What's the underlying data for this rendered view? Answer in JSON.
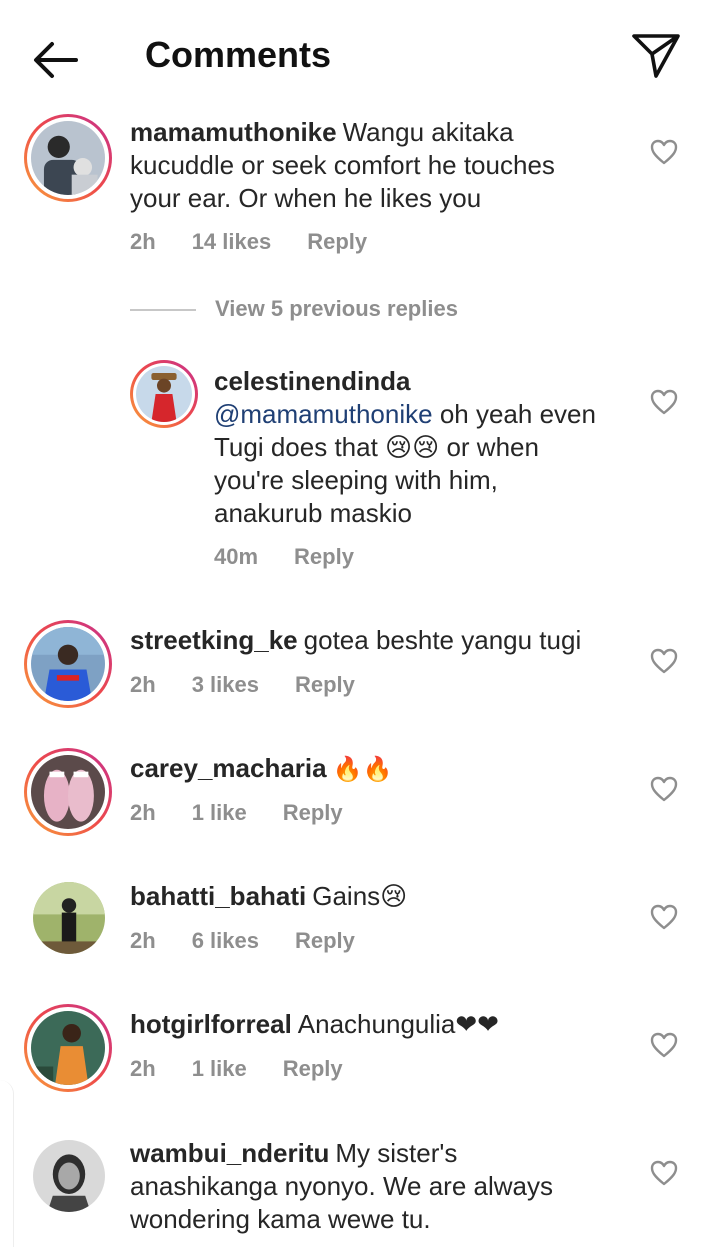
{
  "header": {
    "title": "Comments",
    "back_icon": "arrow-left-icon",
    "share_icon": "paper-plane-icon"
  },
  "comments": [
    {
      "username": "mamamuthonike",
      "text": "Wangu akitaka kucuddle or seek comfort he touches your ear. Or when he likes you",
      "time": "2h",
      "likes": "14 likes",
      "reply": "Reply"
    },
    {
      "username": "streetking_ke",
      "text": "gotea beshte yangu tugi",
      "time": "2h",
      "likes": "3 likes",
      "reply": "Reply"
    },
    {
      "username": "carey_macharia",
      "text": "🔥🔥",
      "time": "2h",
      "likes": "1 like",
      "reply": "Reply"
    },
    {
      "username": "bahatti_bahati",
      "text": "Gains😢",
      "time": "2h",
      "likes": "6 likes",
      "reply": "Reply"
    },
    {
      "username": "hotgirlforreal",
      "text": "Anachungulia❤❤",
      "time": "2h",
      "likes": "1 like",
      "reply": "Reply"
    },
    {
      "username": "wambui_nderitu",
      "text": "My sister's anashikanga nyonyo. We are always wondering kama wewe tu.",
      "time": "",
      "likes": "",
      "reply": ""
    }
  ],
  "view_replies": "View 5 previous replies",
  "reply": {
    "username": "celestinendinda",
    "mention": "@mamamuthonike",
    "text": "oh yeah even Tugi does that 😢😢 or when you're sleeping with him, anakurub maskio",
    "time": "40m",
    "reply": "Reply"
  },
  "colors": {
    "accent_ring_start": "#f9a13b",
    "accent_ring_end": "#c62f8f",
    "meta": "#8e8e8e",
    "mention": "#1f3f74"
  }
}
